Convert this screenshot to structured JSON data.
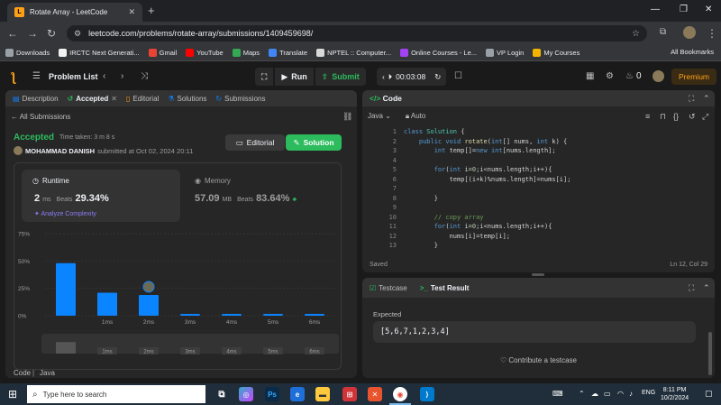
{
  "browser": {
    "tab_title": "Rotate Array - LeetCode",
    "url": "leetcode.com/problems/rotate-array/submissions/1409459698/",
    "bookmarks": [
      {
        "label": "Downloads",
        "color": "#9aa0a6"
      },
      {
        "label": "IRCTC Next Generati...",
        "color": "#f2f2f2"
      },
      {
        "label": "Gmail",
        "color": "#ea4335"
      },
      {
        "label": "YouTube",
        "color": "#ff0000"
      },
      {
        "label": "Maps",
        "color": "#34a853"
      },
      {
        "label": "Translate",
        "color": "#4285f4"
      },
      {
        "label": "NPTEL :: Computer...",
        "color": "#d9d9d9"
      },
      {
        "label": "Online Courses - Le...",
        "color": "#a142f4"
      },
      {
        "label": "VP Login",
        "color": "#9aa0a6"
      },
      {
        "label": "My Courses",
        "color": "#f4b400"
      }
    ],
    "all_bookmarks": "All Bookmarks"
  },
  "leetcode": {
    "problem_list": "Problem List",
    "run": "Run",
    "submit": "Submit",
    "timer": "00:03:08",
    "streak": "0",
    "premium": "Premium"
  },
  "left": {
    "tabs": [
      "Description",
      "Accepted",
      "Editorial",
      "Solutions",
      "Submissions"
    ],
    "all_submissions": "All Submissions",
    "status": "Accepted",
    "time_taken": "Time taken: 3 m 8 s",
    "author": "MOHAMMAD DANISH",
    "submitted": "submitted at Oct 02, 2024 20:11",
    "editorial_btn": "Editorial",
    "solution_btn": "Solution",
    "runtime_label": "Runtime",
    "runtime_value": "2",
    "runtime_unit": "ms",
    "runtime_beats_label": "Beats",
    "runtime_beats": "29.34%",
    "analyze": "Analyze Complexity",
    "memory_label": "Memory",
    "memory_value": "57.09",
    "memory_unit": "MB",
    "memory_beats_label": "Beats",
    "memory_beats": "83.64%",
    "footer_code": "Code",
    "footer_lang": "Java"
  },
  "chart_data": {
    "type": "bar",
    "categories": [
      "",
      "1ms",
      "2ms",
      "3ms",
      "4ms",
      "5ms",
      "6ms"
    ],
    "values": [
      48,
      21,
      19,
      1,
      1,
      1,
      1
    ],
    "highlight_index": 2,
    "ylim": [
      0,
      75
    ],
    "yticks": [
      "75%",
      "50%",
      "25%",
      "0%"
    ],
    "ytick_values": [
      75,
      50,
      25,
      0
    ],
    "colors": {
      "bar": "#0a84ff",
      "grid": "#3a3a3a"
    }
  },
  "editor": {
    "title": "Code",
    "language": "Java",
    "mode": "Auto",
    "lines": [
      {
        "n": "1",
        "html": "<span class=\"kw\">class</span> <span class=\"ty\">Solution</span> {"
      },
      {
        "n": "2",
        "html": "    <span class=\"kw\">public void</span> <span class=\"fn\">rotate</span>(<span class=\"kw\">int</span>[] nums, <span class=\"kw\">int</span> k) {"
      },
      {
        "n": "3",
        "html": "        <span class=\"kw\">int</span> temp[]=<span class=\"kw\">new int</span>[nums.length];"
      },
      {
        "n": "4",
        "html": ""
      },
      {
        "n": "5",
        "html": "        <span class=\"kw\">for</span>(<span class=\"kw\">int</span> i=<span class=\"num\">0</span>;i&lt;nums.length;i++){"
      },
      {
        "n": "6",
        "html": "            temp[(i+k)%nums.length]=nums[i];"
      },
      {
        "n": "7",
        "html": ""
      },
      {
        "n": "8",
        "html": "        }"
      },
      {
        "n": "9",
        "html": ""
      },
      {
        "n": "10",
        "html": "        <span class=\"cm\">// copy array</span>"
      },
      {
        "n": "11",
        "html": "        <span class=\"kw\">for</span>(<span class=\"kw\">int</span> i=<span class=\"num\">0</span>;i&lt;nums.length;i++){"
      },
      {
        "n": "12",
        "html": "            nums[i]=temp[i];"
      },
      {
        "n": "13",
        "html": "        }"
      }
    ],
    "saved": "Saved",
    "cursor": "Ln 12, Col 29"
  },
  "test": {
    "tab_testcase": "Testcase",
    "tab_result": "Test Result",
    "expected_label": "Expected",
    "expected_value": "[5,6,7,1,2,3,4]",
    "contribute": "Contribute a testcase"
  },
  "taskbar": {
    "search_placeholder": "Type here to search",
    "time": "8:11 PM",
    "date": "10/2/2024",
    "lang": "ENG"
  }
}
